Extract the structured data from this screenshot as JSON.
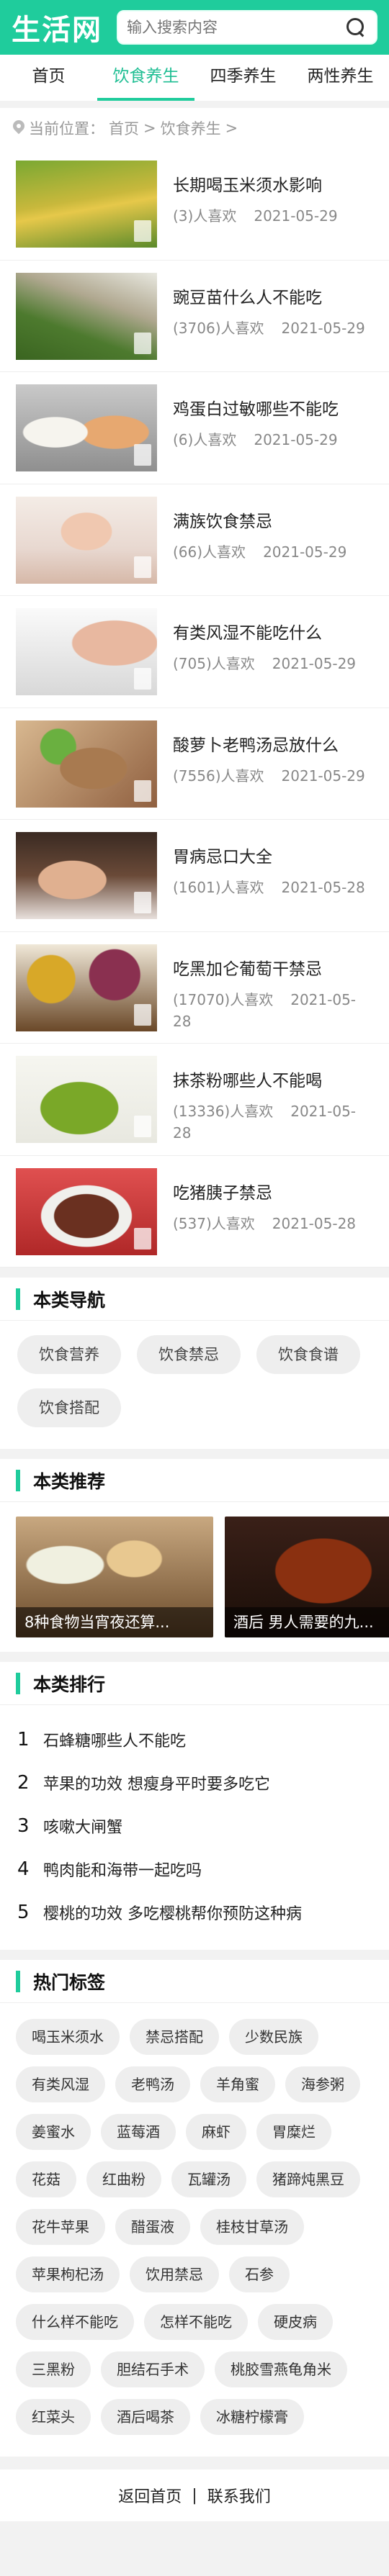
{
  "header": {
    "logo": "生活网",
    "search_placeholder": "输入搜索内容"
  },
  "nav": [
    {
      "label": "首页",
      "active": false
    },
    {
      "label": "饮食养生",
      "active": true
    },
    {
      "label": "四季养生",
      "active": false
    },
    {
      "label": "两性养生",
      "active": false
    }
  ],
  "breadcrumb": {
    "label": "当前位置：",
    "home": "首页",
    "sep1": ">",
    "current": "饮食养生",
    "sep2": ">"
  },
  "articles": [
    {
      "title": "长期喝玉米须水影响",
      "likes": "(3)人喜欢",
      "date": "2021-05-29"
    },
    {
      "title": "豌豆苗什么人不能吃",
      "likes": "(3706)人喜欢",
      "date": "2021-05-29"
    },
    {
      "title": "鸡蛋白过敏哪些不能吃",
      "likes": "(6)人喜欢",
      "date": "2021-05-29"
    },
    {
      "title": "满族饮食禁忌",
      "likes": "(66)人喜欢",
      "date": "2021-05-29"
    },
    {
      "title": "有类风湿不能吃什么",
      "likes": "(705)人喜欢",
      "date": "2021-05-29"
    },
    {
      "title": "酸萝卜老鸭汤忌放什么",
      "likes": "(7556)人喜欢",
      "date": "2021-05-29"
    },
    {
      "title": "胃病忌口大全",
      "likes": "(1601)人喜欢",
      "date": "2021-05-28"
    },
    {
      "title": "吃黑加仑葡萄干禁忌",
      "likes": "(17070)人喜欢",
      "date": "2021-05-28"
    },
    {
      "title": "抹茶粉哪些人不能喝",
      "likes": "(13336)人喜欢",
      "date": "2021-05-28"
    },
    {
      "title": "吃猪胰子禁忌",
      "likes": "(537)人喜欢",
      "date": "2021-05-28"
    }
  ],
  "category_nav": {
    "title": "本类导航",
    "items": [
      "饮食营养",
      "饮食禁忌",
      "饮食食谱",
      "饮食搭配"
    ]
  },
  "recommend": {
    "title": "本类推荐",
    "items": [
      "8种食物当宵夜还算...",
      "酒后 男人需要的九..."
    ]
  },
  "ranking": {
    "title": "本类排行",
    "items": [
      {
        "no": "1",
        "text": "石蜂糖哪些人不能吃"
      },
      {
        "no": "2",
        "text": "苹果的功效 想瘦身平时要多吃它"
      },
      {
        "no": "3",
        "text": "咳嗽大闸蟹"
      },
      {
        "no": "4",
        "text": "鸭肉能和海带一起吃吗"
      },
      {
        "no": "5",
        "text": "樱桃的功效 多吃樱桃帮你预防这种病"
      }
    ]
  },
  "hot_tags": {
    "title": "热门标签",
    "items": [
      "喝玉米须水",
      "禁忌搭配",
      "少数民族",
      "有类风湿",
      "老鸭汤",
      "羊角蜜",
      "海参粥",
      "姜蜜水",
      "蓝莓酒",
      "麻虾",
      "胃糜烂",
      "花菇",
      "红曲粉",
      "瓦罐汤",
      "猪蹄炖黑豆",
      "花牛苹果",
      "醋蛋液",
      "桂枝甘草汤",
      "苹果枸杞汤",
      "饮用禁忌",
      "石参",
      "什么样不能吃",
      "怎样不能吃",
      "硬皮病",
      "三黑粉",
      "胆结石手术",
      "桃胶雪燕龟角米",
      "红菜头",
      "酒后喝茶",
      "冰糖柠檬膏"
    ]
  },
  "footer": {
    "back": "返回首页",
    "sep": "|",
    "contact": "联系我们"
  },
  "colors": {
    "brand": "#1fcc9c",
    "active_text": "#1fbe93"
  }
}
